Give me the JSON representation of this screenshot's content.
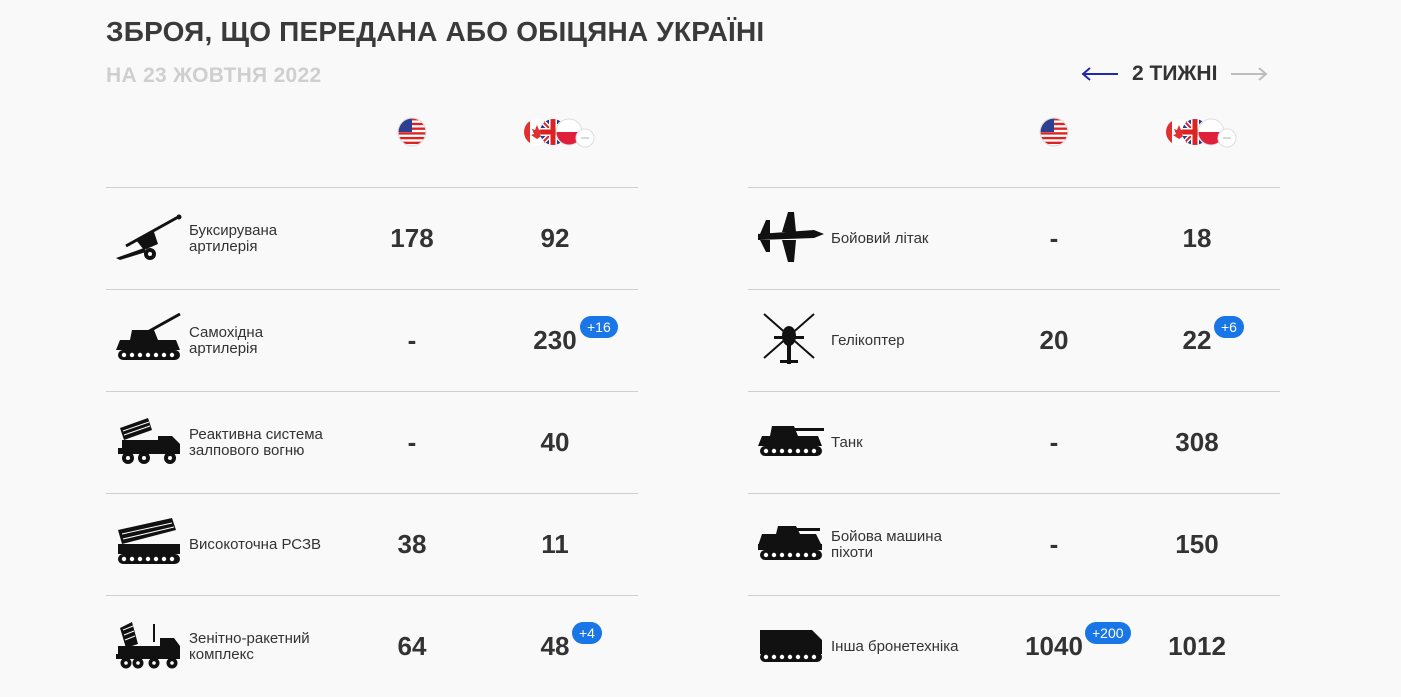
{
  "header": {
    "title": "ЗБРОЯ, ЩО ПЕРЕДАНА АБО ОБІЦЯНА УКРАЇНІ",
    "subtitle": "НА 23 ЖОВТНЯ 2022",
    "nav_label": "2 ТИЖНІ"
  },
  "colors": {
    "accent": "#1976e6",
    "arrow_active": "#1f2aa8",
    "arrow_inactive": "#bdbdbd"
  },
  "columns": {
    "us_flag": "usa-flag-icon",
    "allies_flags": [
      "canada-flag-icon",
      "uk-flag-icon",
      "poland-flag-icon",
      "more-flag-icon"
    ]
  },
  "left_rows": [
    {
      "icon": "towed-artillery-icon",
      "label": "Буксирувана\nартилерія",
      "us": "178",
      "allies": "92",
      "us_delta": "",
      "allies_delta": ""
    },
    {
      "icon": "self-propelled-artillery-icon",
      "label": "Самохідна\nартилерія",
      "us": "-",
      "allies": "230",
      "us_delta": "",
      "allies_delta": "+16"
    },
    {
      "icon": "mlrs-icon",
      "label": "Реактивна система\nзалпового вогню",
      "us": "-",
      "allies": "40",
      "us_delta": "",
      "allies_delta": ""
    },
    {
      "icon": "precision-mlrs-icon",
      "label": "Високоточна РСЗВ",
      "us": "38",
      "allies": "11",
      "us_delta": "",
      "allies_delta": ""
    },
    {
      "icon": "air-defense-icon",
      "label": "Зенітно-ракетний\nкомплекс",
      "us": "64",
      "allies": "48",
      "us_delta": "",
      "allies_delta": "+4"
    }
  ],
  "right_rows": [
    {
      "icon": "fighter-jet-icon",
      "label": "Бойовий літак",
      "us": "-",
      "allies": "18",
      "us_delta": "",
      "allies_delta": ""
    },
    {
      "icon": "helicopter-icon",
      "label": "Гелікоптер",
      "us": "20",
      "allies": "22",
      "us_delta": "",
      "allies_delta": "+6"
    },
    {
      "icon": "tank-icon",
      "label": "Танк",
      "us": "-",
      "allies": "308",
      "us_delta": "",
      "allies_delta": ""
    },
    {
      "icon": "ifv-icon",
      "label": "Бойова машина\nпіхоти",
      "us": "-",
      "allies": "150",
      "us_delta": "",
      "allies_delta": ""
    },
    {
      "icon": "apc-icon",
      "label": "Інша бронетехніка",
      "us": "1040",
      "allies": "1012",
      "us_delta": "+200",
      "allies_delta": ""
    }
  ]
}
